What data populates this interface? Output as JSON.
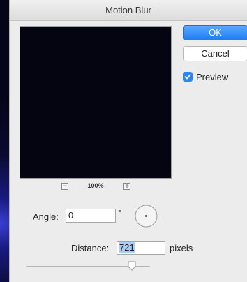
{
  "dialog": {
    "title": "Motion Blur"
  },
  "preview": {
    "zoom_out_symbol": "−",
    "zoom_level": "100%",
    "zoom_in_symbol": "+"
  },
  "buttons": {
    "ok_label": "OK",
    "cancel_label": "Cancel"
  },
  "preview_toggle": {
    "label": "Preview",
    "checked": true
  },
  "angle": {
    "label": "Angle:",
    "value": "0",
    "unit": "°"
  },
  "distance": {
    "label": "Distance:",
    "value": "721",
    "unit": "pixels"
  },
  "distance_slider": {
    "position_fraction": 0.82
  },
  "colors": {
    "accent": "#1f7cf2",
    "preview_bg": "#050511",
    "dialog_bg": "#ececec"
  },
  "icons": {
    "angle_dial": "angle-dial-icon",
    "checkmark": "checkmark-icon"
  }
}
